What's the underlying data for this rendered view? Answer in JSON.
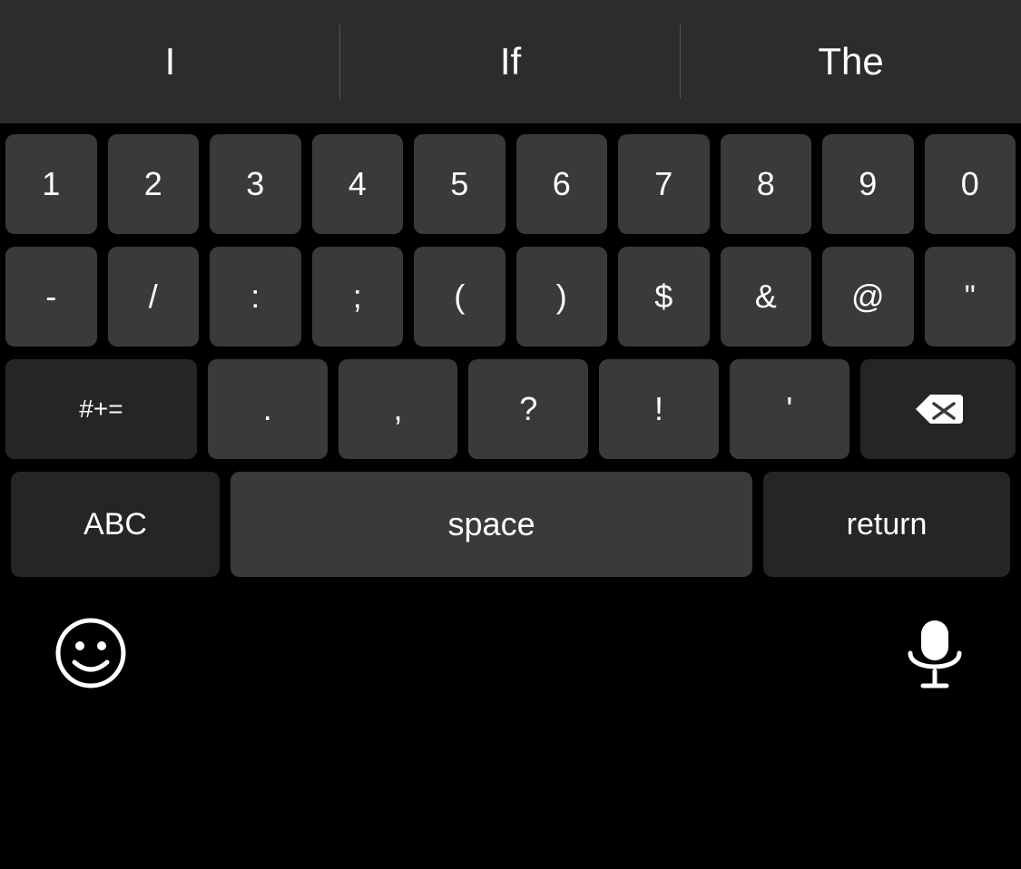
{
  "autocomplete": {
    "items": [
      {
        "id": "suggestion-I",
        "label": "I"
      },
      {
        "id": "suggestion-If",
        "label": "If"
      },
      {
        "id": "suggestion-The",
        "label": "The"
      }
    ]
  },
  "keyboard": {
    "row1": [
      "1",
      "2",
      "3",
      "4",
      "5",
      "6",
      "7",
      "8",
      "9",
      "0"
    ],
    "row2": [
      "-",
      "/",
      ":",
      ";",
      "(",
      ")",
      "$",
      "&",
      "@",
      "\""
    ],
    "row3_special": "#+=",
    "row3_mid": [
      ".",
      ",",
      "?",
      "!",
      "'"
    ],
    "bottom": {
      "abc": "ABC",
      "space": "space",
      "return": "return"
    }
  }
}
